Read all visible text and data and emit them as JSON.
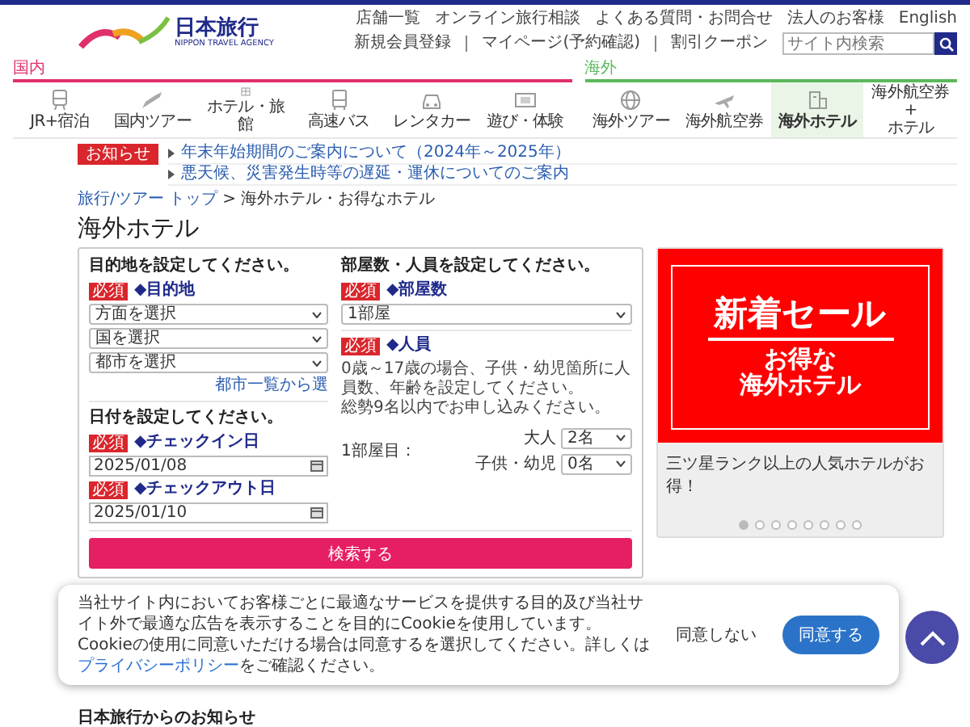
{
  "top_links": [
    "店舗一覧",
    "オンライン旅行相談",
    "よくある質問・お問合せ",
    "法人のお客様",
    "English"
  ],
  "logo": {
    "name": "日本旅行",
    "subtitle": "NIPPON TRAVEL AGENCY"
  },
  "account_links": [
    "新規会員登録",
    "マイページ(予約確認)",
    "割引クーポン"
  ],
  "search": {
    "placeholder": "サイト内検索"
  },
  "nav_groups": [
    {
      "title": "国内",
      "color": "#e0306a",
      "items": [
        {
          "label": "JR+宿泊",
          "selected": false
        },
        {
          "label": "国内ツアー",
          "selected": false
        },
        {
          "label": "ホテル・旅館",
          "selected": false
        },
        {
          "label": "高速バス",
          "selected": false
        },
        {
          "label": "レンタカー",
          "selected": false
        },
        {
          "label": "遊び・体験",
          "selected": false
        }
      ]
    },
    {
      "title": "海外",
      "color": "#5cb85c",
      "items": [
        {
          "label": "海外ツアー",
          "selected": false
        },
        {
          "label": "海外航空券",
          "selected": false
        },
        {
          "label": "海外ホテル",
          "selected": true
        },
        {
          "label": "海外航空券\n+\nホテル",
          "selected": false
        }
      ]
    }
  ],
  "notices": {
    "badge": "お知らせ",
    "items": [
      "年末年始期間のご案内について（2024年～2025年）",
      "悪天候、災害発生時等の遅延・運休についてのご案内"
    ]
  },
  "breadcrumb": {
    "links": [
      "旅行/ツアー トップ"
    ],
    "separator": ">",
    "current": "海外ホテル・お得なホテル"
  },
  "page_title": "海外ホテル",
  "form": {
    "destination": {
      "heading": "目的地を設定してください。",
      "badge": "必須",
      "label": "◆目的地",
      "selects": [
        "方面を選択",
        "国を選択",
        "都市を選択"
      ],
      "link": "都市一覧から選"
    },
    "dates": {
      "heading": "日付を設定してください。",
      "fields": [
        {
          "badge": "必須",
          "label": "◆チェックイン日",
          "value": "2025/01/08"
        },
        {
          "badge": "必須",
          "label": "◆チェックアウト日",
          "value": "2025/01/10"
        }
      ]
    },
    "rooms": {
      "heading": "部屋数・人員を設定してください。",
      "badge": "必須",
      "label": "◆部屋数",
      "value": "1部屋"
    },
    "people": {
      "badge": "必須",
      "label": "◆人員",
      "note_lines": [
        "0歳～17歳の場合、子供・幼児箇所に人員数、年齢を設定してください。",
        "総勢9名以内でお申し込みください。"
      ],
      "room_label": "1部屋目：",
      "counts": [
        {
          "label": "大人",
          "value": "2名"
        },
        {
          "label": "子供・幼児",
          "value": "0名"
        }
      ]
    },
    "submit": "検索する"
  },
  "banner": {
    "headline": "新着セール",
    "sublines": [
      "お得な",
      "海外ホテル"
    ],
    "caption": "三ツ星ランク以上の人気ホテルがお得！",
    "slides": [
      {
        "selected": true
      },
      {
        "selected": false
      },
      {
        "selected": false
      },
      {
        "selected": false
      },
      {
        "selected": false
      },
      {
        "selected": false
      },
      {
        "selected": false
      },
      {
        "selected": false
      }
    ]
  },
  "next_section_title": "日本旅行からのお知らせ",
  "cookie": {
    "text_before": "当社サイト内においてお客様ごとに最適なサービスを提供する目的及び当社サイト外で最適な広告を表示することを目的にCookieを使用しています。Cookieの使用に同意いただける場合は同意するを選択してください。詳しくは",
    "link": "プライバシーポリシー",
    "text_after": "をご確認ください。",
    "decline": "同意しない",
    "accept": "同意する"
  }
}
